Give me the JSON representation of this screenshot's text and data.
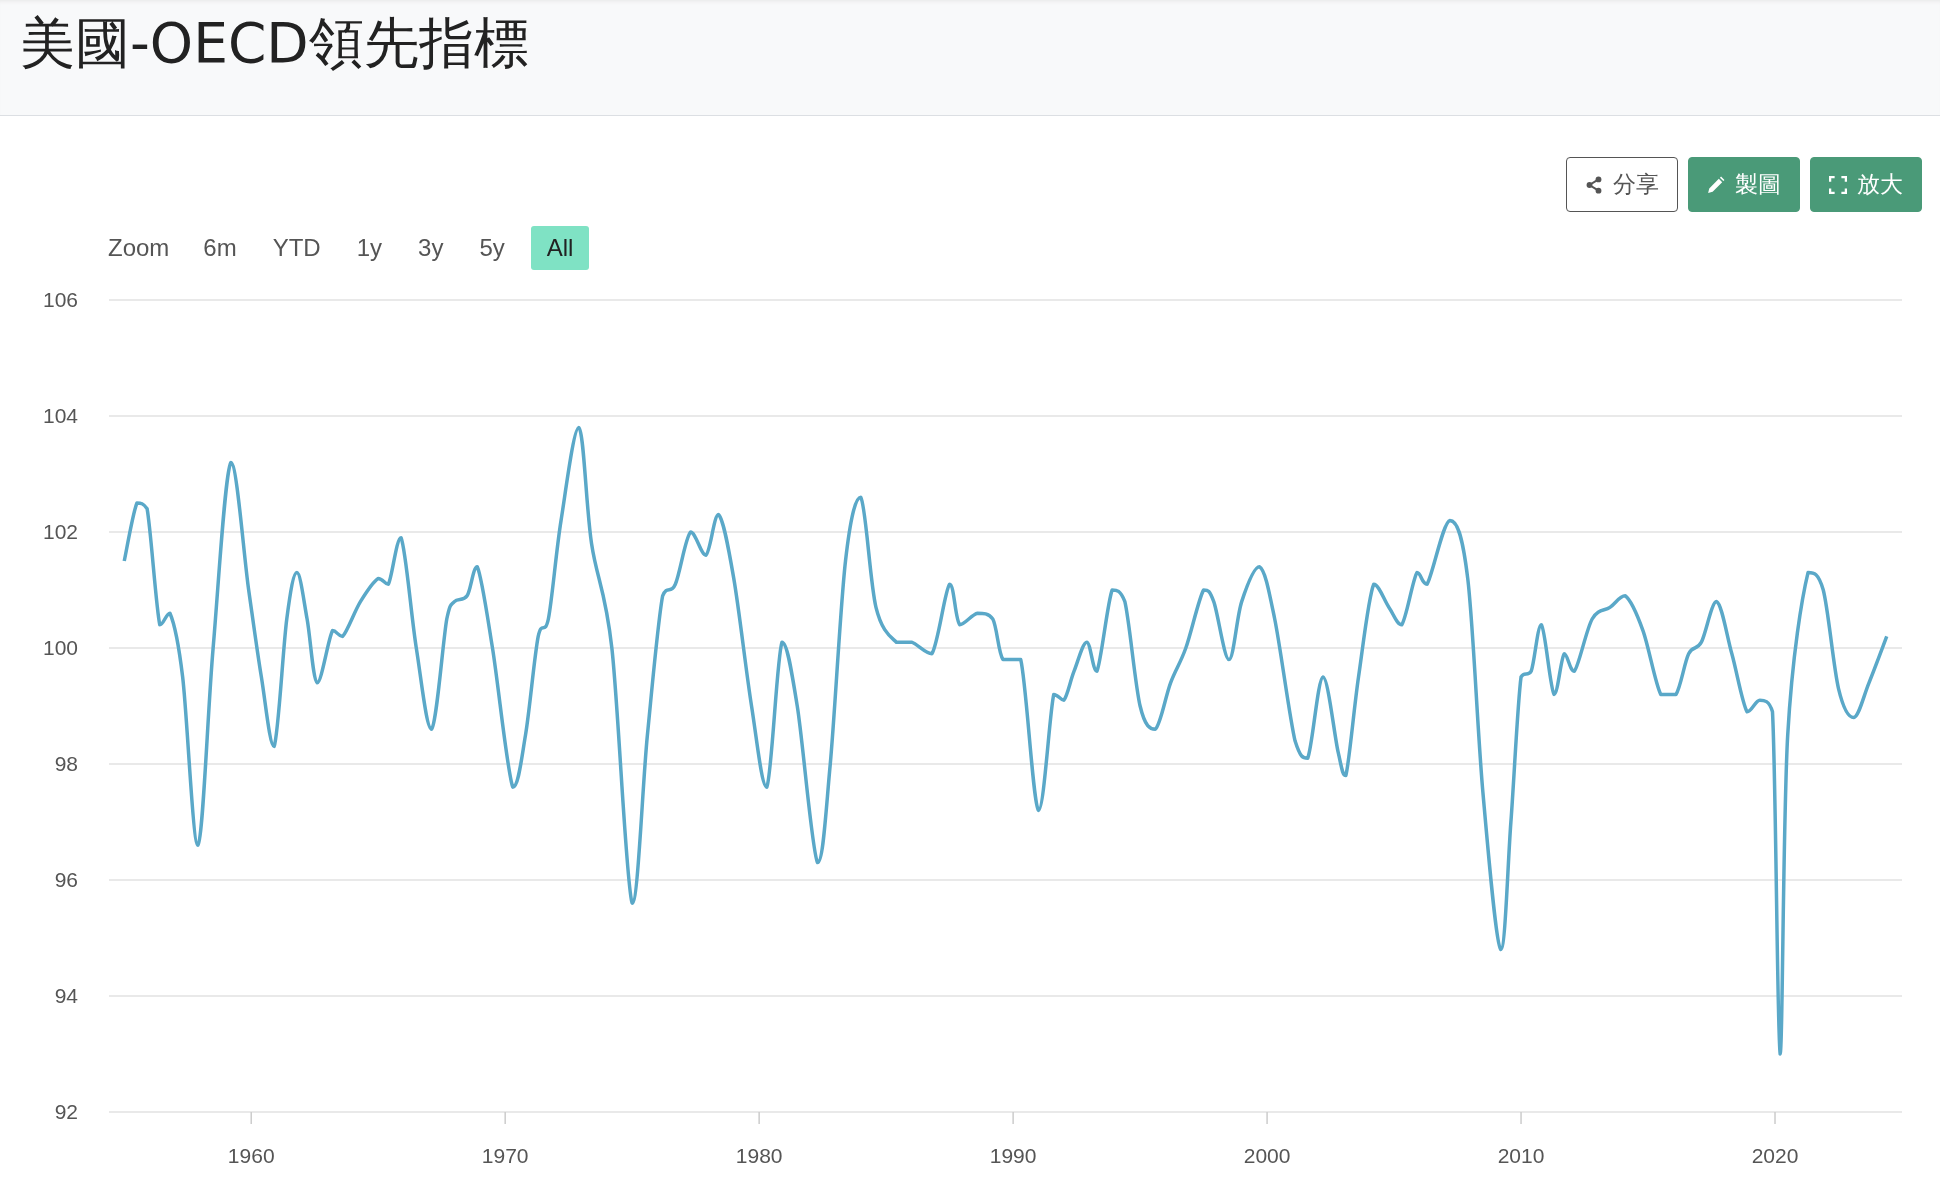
{
  "page": {
    "title": "美國-OECD領先指標"
  },
  "toolbar": {
    "buttons": [
      {
        "label": "分享",
        "kind": "share"
      },
      {
        "label": "製圖",
        "kind": "edit"
      },
      {
        "label": "放大",
        "kind": "expand"
      }
    ]
  },
  "range_selector": {
    "label": "Zoom",
    "options": [
      {
        "label": "6m",
        "selected": false
      },
      {
        "label": "YTD",
        "selected": false
      },
      {
        "label": "1y",
        "selected": false
      },
      {
        "label": "3y",
        "selected": false
      },
      {
        "label": "5y",
        "selected": false
      },
      {
        "label": "All",
        "selected": true
      }
    ]
  },
  "chart": {
    "chart_data": {
      "type": "line",
      "grid": true,
      "xlim": [
        1954.4,
        2025.0
      ],
      "ylim": [
        92,
        106
      ],
      "xticks": [
        1960,
        1970,
        1980,
        1990,
        2000,
        2010,
        2020
      ],
      "yticks": [
        92,
        94,
        96,
        98,
        100,
        102,
        104,
        106
      ],
      "x": [
        1955.0,
        1955.5,
        1955.9,
        1956.4,
        1956.8,
        1957.3,
        1957.9,
        1958.5,
        1959.2,
        1959.9,
        1960.4,
        1960.9,
        1961.4,
        1961.8,
        1962.2,
        1962.6,
        1963.2,
        1963.6,
        1964.3,
        1965.0,
        1965.4,
        1965.9,
        1966.5,
        1967.1,
        1967.7,
        1968.0,
        1968.5,
        1968.9,
        1969.5,
        1970.3,
        1970.8,
        1971.3,
        1971.7,
        1972.2,
        1972.9,
        1973.4,
        1974.2,
        1975.0,
        1975.6,
        1976.2,
        1976.7,
        1977.3,
        1977.9,
        1978.4,
        1979.0,
        1979.7,
        1980.3,
        1980.9,
        1981.5,
        1982.3,
        1982.8,
        1983.4,
        1984.0,
        1984.6,
        1985.4,
        1986.0,
        1986.8,
        1987.5,
        1987.9,
        1988.6,
        1989.2,
        1989.6,
        1990.3,
        1991.0,
        1991.6,
        1992.0,
        1992.4,
        1992.9,
        1993.3,
        1993.9,
        1994.4,
        1995.0,
        1995.6,
        1996.2,
        1996.8,
        1997.5,
        1997.9,
        1998.5,
        1999.0,
        1999.7,
        2000.3,
        2001.1,
        2001.6,
        2002.2,
        2002.8,
        2003.1,
        2003.6,
        2004.2,
        2004.8,
        2005.3,
        2005.9,
        2006.3,
        2007.2,
        2007.9,
        2008.5,
        2009.2,
        2009.6,
        2010.0,
        2010.4,
        2010.8,
        2011.3,
        2011.7,
        2012.1,
        2012.8,
        2013.5,
        2014.1,
        2014.8,
        2015.5,
        2016.1,
        2016.6,
        2017.1,
        2017.7,
        2018.3,
        2018.9,
        2019.4,
        2019.9,
        2020.2,
        2020.5,
        2021.3,
        2021.9,
        2022.5,
        2023.1,
        2023.7,
        2024.4
      ],
      "values": [
        101.5,
        102.5,
        102.4,
        100.4,
        100.6,
        99.5,
        96.6,
        100,
        103.2,
        101.0,
        99.5,
        98.3,
        100.5,
        101.3,
        100.5,
        99.4,
        100.3,
        100.2,
        100.8,
        101.2,
        101.1,
        101.9,
        100,
        98.6,
        100.5,
        100.8,
        100.9,
        101.4,
        100,
        97.6,
        98.5,
        100.2,
        100.5,
        102.2,
        103.8,
        101.8,
        100,
        95.6,
        98.5,
        100.9,
        101.1,
        102.0,
        101.6,
        102.3,
        101.2,
        99,
        97.6,
        100.1,
        99,
        96.3,
        98,
        101.5,
        102.6,
        100.7,
        100.1,
        100.1,
        99.9,
        101.1,
        100.4,
        100.6,
        100.5,
        99.8,
        99.8,
        97.2,
        99.2,
        99.1,
        99.6,
        100.1,
        99.6,
        101.0,
        100.8,
        99.0,
        98.6,
        99.4,
        100.0,
        101.0,
        100.8,
        99.8,
        100.8,
        101.4,
        100.5,
        98.4,
        98.1,
        99.5,
        98.2,
        97.8,
        99.5,
        101.1,
        100.7,
        100.4,
        101.3,
        101.1,
        102.2,
        101.2,
        97.5,
        94.8,
        97,
        99.5,
        99.6,
        100.4,
        99.2,
        99.9,
        99.6,
        100.5,
        100.7,
        100.9,
        100.3,
        99.2,
        99.2,
        99.9,
        100.1,
        100.8,
        99.9,
        98.9,
        99.1,
        98.9,
        93.0,
        98.5,
        101.3,
        101.0,
        99.3,
        98.8,
        99.4,
        100.2
      ]
    }
  }
}
